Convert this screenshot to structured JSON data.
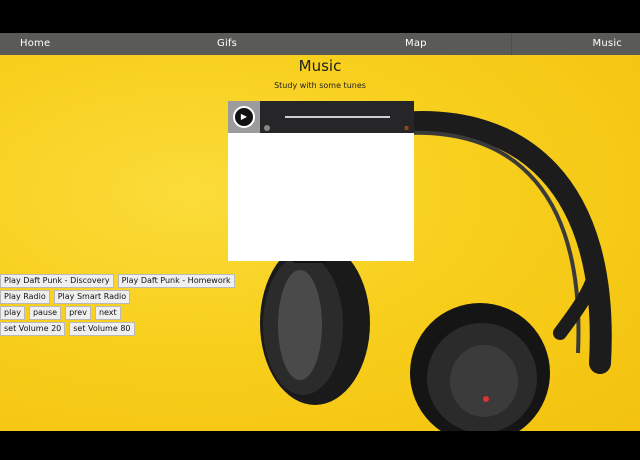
{
  "nav": {
    "items": [
      "Home",
      "Gifs",
      "Map",
      "Music"
    ],
    "active": "Music"
  },
  "page": {
    "title": "Music",
    "subtitle": "Study with some tunes"
  },
  "player": {
    "play_symbol": "▶",
    "logo_symbol": "≣"
  },
  "controls": {
    "row1": [
      "Play Daft Punk - Discovery",
      "Play Daft Punk - Homework"
    ],
    "row2": [
      "Play Radio",
      "Play Smart Radio"
    ],
    "row3": [
      "play",
      "pause",
      "prev",
      "next"
    ],
    "row4": [
      "set Volume 20",
      "set Volume 80"
    ]
  },
  "colors": {
    "background": "#f8cf1d",
    "nav": "#5a5a58"
  }
}
